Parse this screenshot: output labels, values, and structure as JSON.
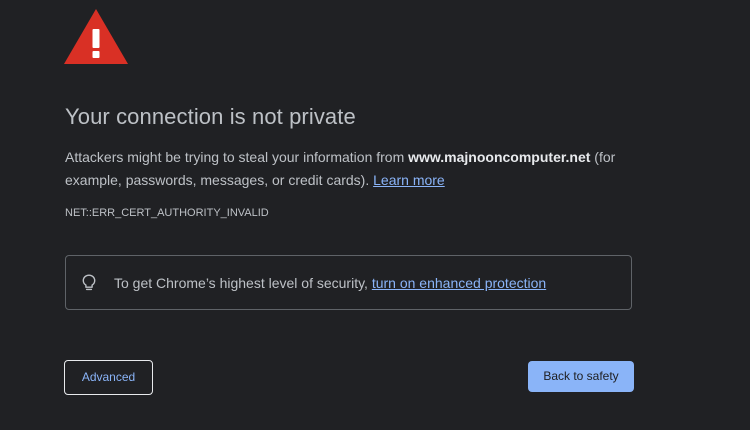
{
  "icons": {
    "warning": "warning-triangle-icon",
    "bulb": "lightbulb-icon"
  },
  "colors": {
    "background": "#202124",
    "text": "#bdc1c6",
    "link": "#8ab4f8",
    "warning_red": "#d93025",
    "primary_button": "#8ab4f8"
  },
  "main": {
    "heading": "Your connection is not private",
    "explanation_prefix": "Attackers might be trying to steal your information from ",
    "domain": "www.majnooncomputer.net",
    "explanation_suffix": " (for example, passwords, messages, or credit cards). ",
    "learn_more": "Learn more",
    "error_code": "NET::ERR_CERT_AUTHORITY_INVALID"
  },
  "enhanced_protection": {
    "text": "To get Chrome’s highest level of security, ",
    "link": "turn on enhanced protection"
  },
  "buttons": {
    "advanced": "Advanced",
    "back_to_safety": "Back to safety"
  }
}
